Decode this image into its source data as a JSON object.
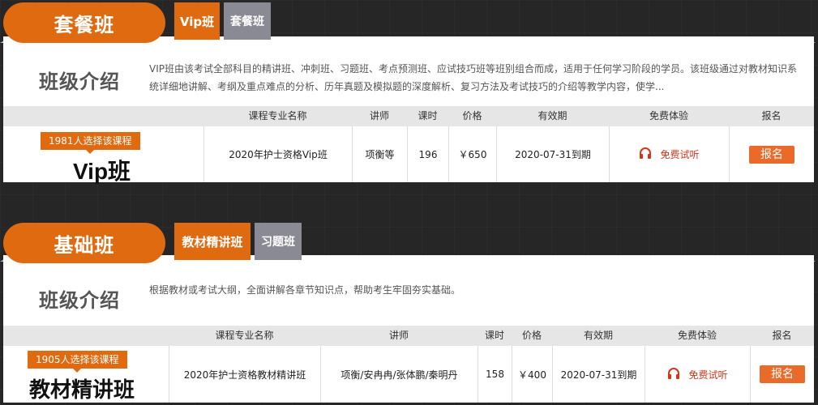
{
  "sections": [
    {
      "heading": "套餐班",
      "tabs": [
        "Vip班",
        "套餐班"
      ],
      "intro_title": "班级介绍",
      "intro_text": "VIP班由该考试全部科目的精讲班、冲刺班、习题班、考点预测班、应试技巧班等班别组合而成，适用于任何学习阶段的学员。该班级通过对教材知识系统详细地讲解、考纲及重点难点的分析、历年真题及模拟题的深度解析、复习方法及考试技巧的介绍等教学内容，使学...",
      "columns": [
        "课程专业名称",
        "讲师",
        "课时",
        "价格",
        "有效期",
        "免费体验",
        "报名"
      ],
      "badge": "1981人选择该课程",
      "course_label": "Vip班",
      "row": {
        "name": "2020年护士资格Vip班",
        "teacher": "项衡等",
        "hours": "196",
        "price": "￥650",
        "validity": "2020-07-31到期",
        "trial": "免费试听",
        "signup": "报名"
      }
    },
    {
      "heading": "基础班",
      "tabs": [
        "教材精讲班",
        "习题班"
      ],
      "intro_title": "班级介绍",
      "intro_text": "根据教材或考试大纲，全面讲解各章节知识点，帮助考生牢固夯实基础。",
      "columns": [
        "课程专业名称",
        "讲师",
        "课时",
        "价格",
        "有效期",
        "免费体验",
        "报名"
      ],
      "badge": "1905人选择该课程",
      "course_label": "教材精讲班",
      "row": {
        "name": "2020年护士资格教材精讲班",
        "teacher": "项衡/安冉冉/张体鹏/秦明丹",
        "hours": "158",
        "price": "￥400",
        "validity": "2020-07-31到期",
        "trial": "免费试听",
        "signup": "报名"
      }
    }
  ],
  "colors": {
    "accent": "#e06a10",
    "inactive_tab": "#8a8a94",
    "trial_red": "#d9331a"
  },
  "icons": {
    "trial": "headphones-icon"
  }
}
